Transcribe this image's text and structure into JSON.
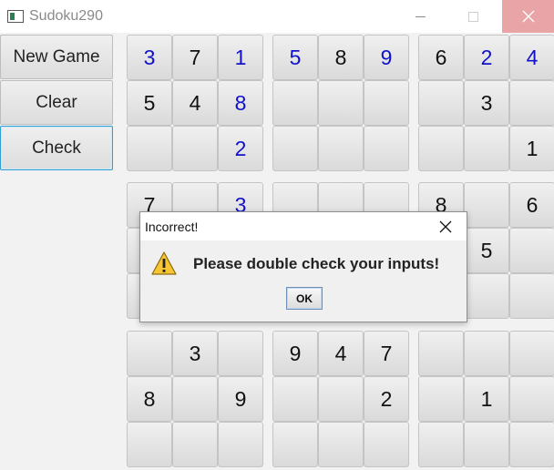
{
  "window": {
    "title": "Sudoku290",
    "close_icon": "close-icon",
    "minimize_icon": "minimize-icon",
    "maximize_icon": "maximize-icon"
  },
  "controls": {
    "new_game_label": "New Game",
    "clear_label": "Clear",
    "check_label": "Check"
  },
  "grid": {
    "rows": [
      [
        {
          "v": "3",
          "c": "b"
        },
        {
          "v": "7",
          "c": "k"
        },
        {
          "v": "1",
          "c": "b"
        },
        {
          "v": "5",
          "c": "b"
        },
        {
          "v": "8",
          "c": "k"
        },
        {
          "v": "9",
          "c": "b"
        },
        {
          "v": "6",
          "c": "k"
        },
        {
          "v": "2",
          "c": "b"
        },
        {
          "v": "4",
          "c": "b"
        }
      ],
      [
        {
          "v": "5",
          "c": "k"
        },
        {
          "v": "4",
          "c": "k"
        },
        {
          "v": "8",
          "c": "b"
        },
        {
          "v": "",
          "c": "k"
        },
        {
          "v": "",
          "c": "k"
        },
        {
          "v": "",
          "c": "k"
        },
        {
          "v": "",
          "c": "k"
        },
        {
          "v": "3",
          "c": "k"
        },
        {
          "v": "",
          "c": "k"
        }
      ],
      [
        {
          "v": "",
          "c": "k"
        },
        {
          "v": "",
          "c": "k"
        },
        {
          "v": "2",
          "c": "b"
        },
        {
          "v": "",
          "c": "k"
        },
        {
          "v": "",
          "c": "k"
        },
        {
          "v": "",
          "c": "k"
        },
        {
          "v": "",
          "c": "k"
        },
        {
          "v": "",
          "c": "k"
        },
        {
          "v": "1",
          "c": "k"
        }
      ],
      [
        {
          "v": "7",
          "c": "k"
        },
        {
          "v": "",
          "c": "k"
        },
        {
          "v": "3",
          "c": "b"
        },
        {
          "v": "",
          "c": "k"
        },
        {
          "v": "",
          "c": "k"
        },
        {
          "v": "",
          "c": "k"
        },
        {
          "v": "8",
          "c": "k"
        },
        {
          "v": "",
          "c": "k"
        },
        {
          "v": "6",
          "c": "k"
        }
      ],
      [
        {
          "v": "",
          "c": "k"
        },
        {
          "v": "",
          "c": "k"
        },
        {
          "v": "",
          "c": "k"
        },
        {
          "v": "",
          "c": "k"
        },
        {
          "v": "",
          "c": "k"
        },
        {
          "v": "",
          "c": "k"
        },
        {
          "v": "",
          "c": "k"
        },
        {
          "v": "5",
          "c": "k"
        },
        {
          "v": "",
          "c": "k"
        }
      ],
      [
        {
          "v": "",
          "c": "k"
        },
        {
          "v": "",
          "c": "k"
        },
        {
          "v": "",
          "c": "k"
        },
        {
          "v": "",
          "c": "k"
        },
        {
          "v": "",
          "c": "k"
        },
        {
          "v": "",
          "c": "k"
        },
        {
          "v": "",
          "c": "k"
        },
        {
          "v": "",
          "c": "k"
        },
        {
          "v": "",
          "c": "k"
        }
      ],
      [
        {
          "v": "",
          "c": "k"
        },
        {
          "v": "3",
          "c": "k"
        },
        {
          "v": "",
          "c": "k"
        },
        {
          "v": "9",
          "c": "k"
        },
        {
          "v": "4",
          "c": "k"
        },
        {
          "v": "7",
          "c": "k"
        },
        {
          "v": "",
          "c": "k"
        },
        {
          "v": "",
          "c": "k"
        },
        {
          "v": "",
          "c": "k"
        }
      ],
      [
        {
          "v": "8",
          "c": "k"
        },
        {
          "v": "",
          "c": "k"
        },
        {
          "v": "9",
          "c": "k"
        },
        {
          "v": "",
          "c": "k"
        },
        {
          "v": "",
          "c": "k"
        },
        {
          "v": "2",
          "c": "k"
        },
        {
          "v": "",
          "c": "k"
        },
        {
          "v": "1",
          "c": "k"
        },
        {
          "v": "",
          "c": "k"
        }
      ],
      [
        {
          "v": "",
          "c": "k"
        },
        {
          "v": "",
          "c": "k"
        },
        {
          "v": "",
          "c": "k"
        },
        {
          "v": "",
          "c": "k"
        },
        {
          "v": "",
          "c": "k"
        },
        {
          "v": "",
          "c": "k"
        },
        {
          "v": "",
          "c": "k"
        },
        {
          "v": "",
          "c": "k"
        },
        {
          "v": "",
          "c": "k"
        }
      ]
    ],
    "colors": {
      "b": "#1111cc",
      "k": "#111111"
    }
  },
  "dialog": {
    "title": "Incorrect!",
    "message": "Please double check your inputs!",
    "ok_label": "OK",
    "icon": "warning-icon",
    "close_icon": "close-icon"
  }
}
